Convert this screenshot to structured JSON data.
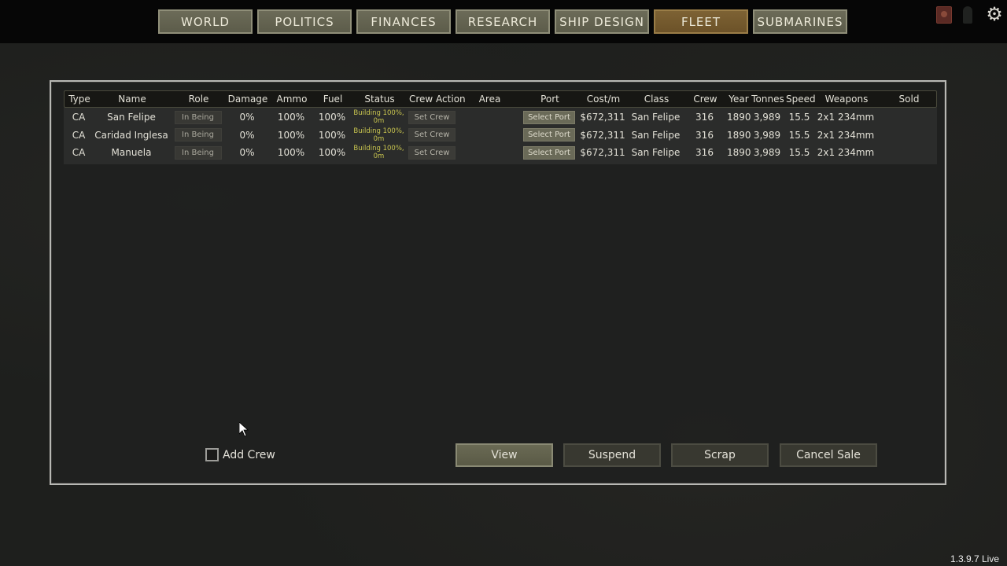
{
  "nav": {
    "tabs": [
      {
        "label": "WORLD",
        "active": false
      },
      {
        "label": "POLITICS",
        "active": false
      },
      {
        "label": "FINANCES",
        "active": false
      },
      {
        "label": "RESEARCH",
        "active": false
      },
      {
        "label": "SHIP DESIGN",
        "active": false
      },
      {
        "label": "FLEET",
        "active": true
      },
      {
        "label": "SUBMARINES",
        "active": false
      }
    ],
    "icons": {
      "book": "book-icon",
      "person": "person-icon",
      "settings": "gear-icon",
      "settings_glyph": "⚙"
    }
  },
  "fleet_table": {
    "headers": {
      "type": "Type",
      "name": "Name",
      "role": "Role",
      "damage": "Damage",
      "ammo": "Ammo",
      "fuel": "Fuel",
      "status": "Status",
      "crew_action": "Crew Action",
      "area": "Area",
      "port": "Port",
      "cost": "Cost/m",
      "class": "Class",
      "crew": "Crew",
      "year": "Year",
      "tonnes": "Tonnes",
      "speed": "Speed",
      "weapons": "Weapons",
      "sold": "Sold"
    },
    "rows": [
      {
        "type": "CA",
        "name": "San Felipe",
        "role": "In Being",
        "damage": "0%",
        "ammo": "100%",
        "fuel": "100%",
        "status": "Building 100%, 0m",
        "crew_action": "Set Crew",
        "area": "",
        "port": "Select Port",
        "cost": "$672,311",
        "class": "San Felipe",
        "crew": "316",
        "year": "1890",
        "tonnes": "3,989",
        "speed": "15.5",
        "weapons": "2x1 234mm",
        "sold": ""
      },
      {
        "type": "CA",
        "name": "Caridad Inglesa",
        "role": "In Being",
        "damage": "0%",
        "ammo": "100%",
        "fuel": "100%",
        "status": "Building 100%, 0m",
        "crew_action": "Set Crew",
        "area": "",
        "port": "Select Port",
        "cost": "$672,311",
        "class": "San Felipe",
        "crew": "316",
        "year": "1890",
        "tonnes": "3,989",
        "speed": "15.5",
        "weapons": "2x1 234mm",
        "sold": ""
      },
      {
        "type": "CA",
        "name": "Manuela",
        "role": "In Being",
        "damage": "0%",
        "ammo": "100%",
        "fuel": "100%",
        "status": "Building 100%, 0m",
        "crew_action": "Set Crew",
        "area": "",
        "port": "Select Port",
        "cost": "$672,311",
        "class": "San Felipe",
        "crew": "316",
        "year": "1890",
        "tonnes": "3,989",
        "speed": "15.5",
        "weapons": "2x1 234mm",
        "sold": ""
      }
    ]
  },
  "footer": {
    "add_crew_label": "Add Crew",
    "add_crew_checked": false,
    "buttons": {
      "view": "View",
      "suspend": "Suspend",
      "scrap": "Scrap",
      "cancel_sale": "Cancel Sale"
    }
  },
  "version": "1.3.9.7 Live",
  "colors": {
    "active_tab": "#7d6234",
    "tab": "#6c6b58",
    "status_text": "#c9c54f"
  }
}
